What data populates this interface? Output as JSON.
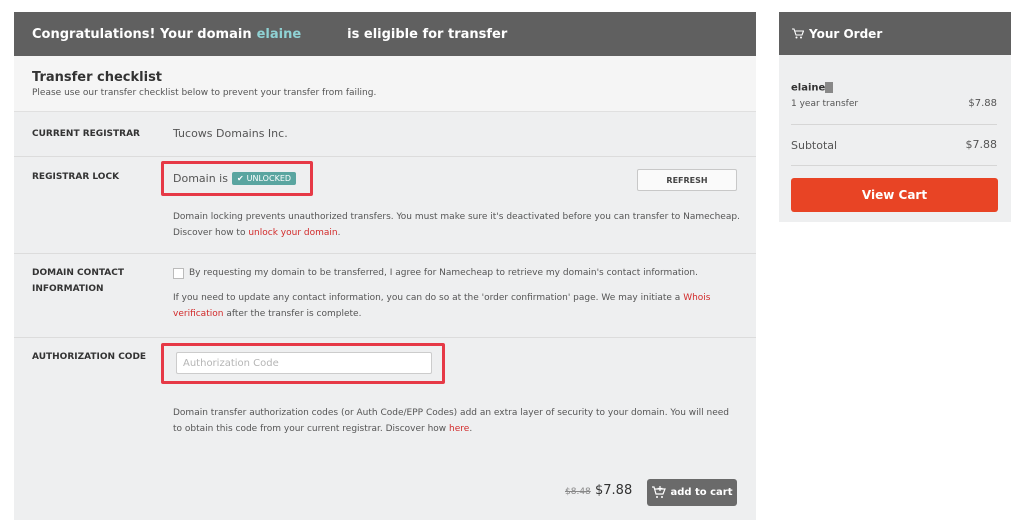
{
  "header": {
    "prefix": "Congratulations! Your domain",
    "domain": "elaine",
    "suffix": "is eligible for transfer"
  },
  "checklist": {
    "title": "Transfer checklist",
    "subtitle": "Please use our transfer checklist below to prevent your transfer from failing."
  },
  "registrar": {
    "label": "CURRENT REGISTRAR",
    "value": "Tucows Domains Inc."
  },
  "lock": {
    "label": "REGISTRAR LOCK",
    "domain_is": "Domain is",
    "status": "UNLOCKED",
    "refresh": "REFRESH",
    "desc1": "Domain locking prevents unauthorized transfers. You must make sure it's deactivated before you can transfer to Namecheap.",
    "desc2": "Discover how to",
    "link": "unlock your domain",
    "desc_end": "."
  },
  "contact": {
    "label": "DOMAIN CONTACT INFORMATION",
    "checkbox_text": "By requesting my domain to be transferred, I agree for Namecheap to retrieve my domain's contact information.",
    "info1": "If you need to update any contact information, you can do so at the 'order confirmation' page. We may initiate a",
    "whois": "Whois",
    "verification": "verification",
    "info2": "after the transfer is complete."
  },
  "auth": {
    "label": "AUTHORIZATION CODE",
    "placeholder": "Authorization Code",
    "desc1": "Domain transfer authorization codes (or Auth Code/EPP Codes) add an extra layer of security to your domain. You will need",
    "desc2": "to obtain this code from your current registrar. Discover how",
    "link": "here",
    "desc_end": "."
  },
  "footer": {
    "old_price": "$8.48",
    "price": "$7.88",
    "add_to_cart": "add to cart"
  },
  "order": {
    "title": "Your Order",
    "item_name": "elaine",
    "item_sub": "1 year transfer",
    "item_price": "$7.88",
    "subtotal_label": "Subtotal",
    "subtotal_value": "$7.88",
    "view_cart": "View Cart"
  },
  "colors": {
    "accent": "#e84425",
    "highlight": "#e63946",
    "unlocked": "#5aa5a0",
    "header": "#606060",
    "link": "#d22b2b"
  }
}
